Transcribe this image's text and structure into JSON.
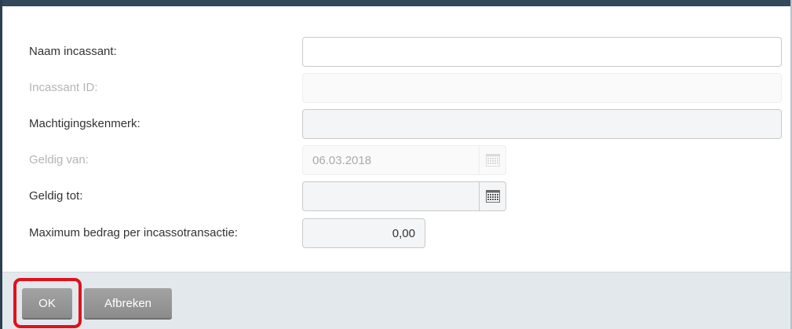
{
  "form": {
    "naam_incassant": {
      "label": "Naam incassant:",
      "value": ""
    },
    "incassant_id": {
      "label": "Incassant ID:",
      "value": ""
    },
    "machtigingskenmerk": {
      "label": "Machtigingskenmerk:",
      "value": ""
    },
    "geldig_van": {
      "label": "Geldig van:",
      "value": "06.03.2018"
    },
    "geldig_tot": {
      "label": "Geldig tot:",
      "value": ""
    },
    "maximum_bedrag": {
      "label": "Maximum bedrag per incassotransactie:",
      "value": "0,00"
    }
  },
  "footer": {
    "ok_label": "OK",
    "cancel_label": "Afbreken"
  },
  "colors": {
    "header_bar": "#34485c",
    "footer_background": "#e3e8ec",
    "button": "#959595",
    "highlight": "#e0101c"
  },
  "icons": {
    "calendar": "calendar-icon"
  }
}
